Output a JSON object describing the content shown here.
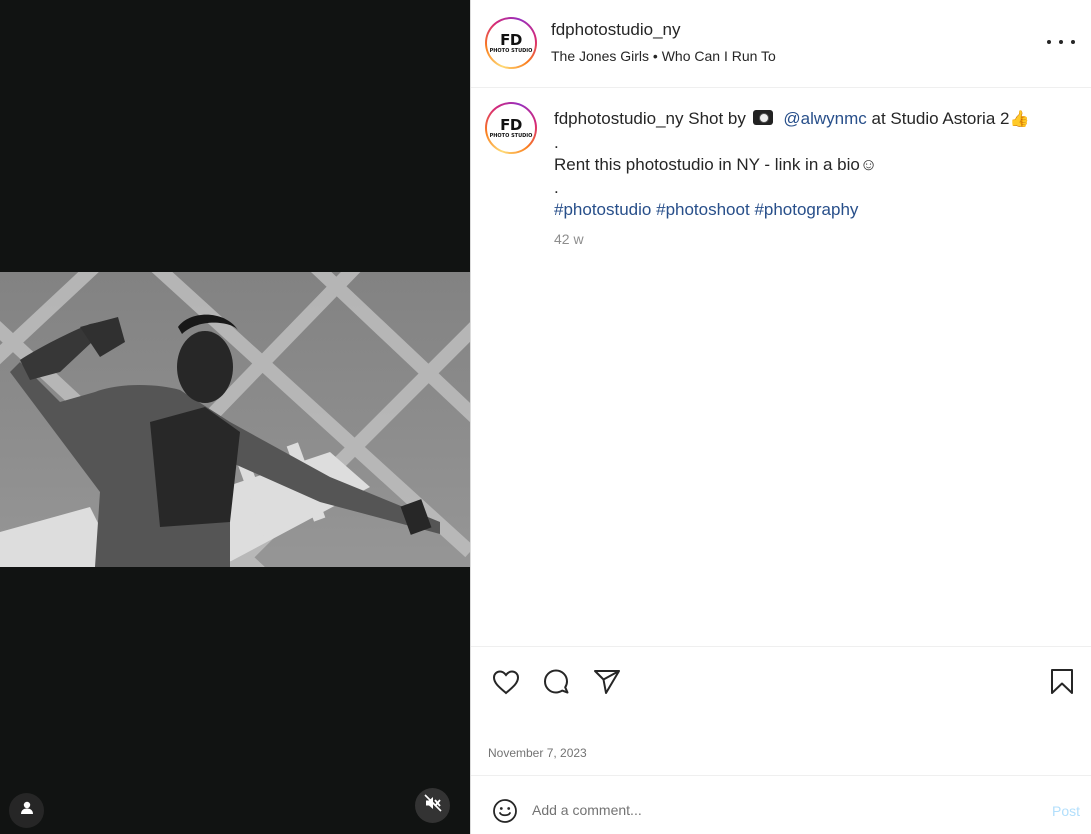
{
  "post": {
    "username": "fdphotostudio_ny",
    "audio": "The Jones Girls • Who Can I Run To",
    "avatar_text": "FD",
    "avatar_subtext": "PHOTO STUDIO"
  },
  "caption": {
    "username": "fdphotostudio_ny",
    "shot_by": "Shot by",
    "mention": "@alwynmc",
    "location_text": "at Studio Astoria 2",
    "dot1": ".",
    "line2": "Rent this photostudio in NY - link in a bio",
    "smile": "☺",
    "dot2": ".",
    "hashtags": [
      "#photostudio",
      "#photoshoot",
      "#photography"
    ],
    "time": "42 w"
  },
  "actions": {
    "like_icon": "heart-icon",
    "comment_icon": "comment-icon",
    "share_icon": "share-icon",
    "save_icon": "bookmark-icon"
  },
  "date": "November 7, 2023",
  "comment": {
    "placeholder": "Add a comment...",
    "post_label": "Post"
  },
  "colors": {
    "link": "#284f8a",
    "post_button": "#b2dffc",
    "media_bg": "#111312"
  }
}
